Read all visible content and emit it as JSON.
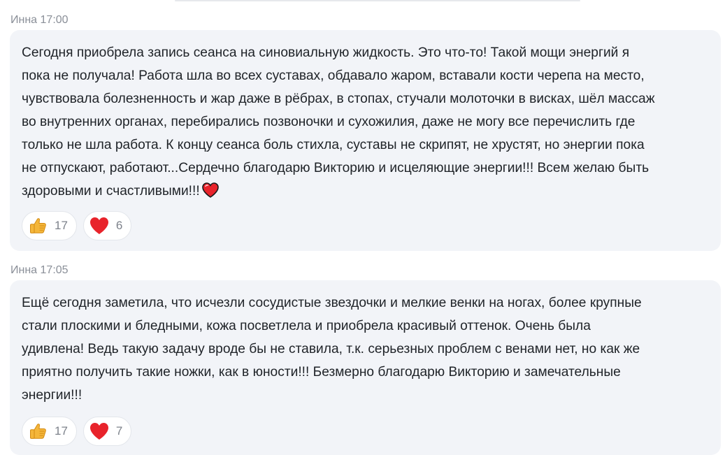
{
  "messages": [
    {
      "author": "Инна",
      "time": "17:00",
      "lines": [
        "Сегодня приобрела запись сеанса на синовиальную жидкость. Это что-то! Такой мощи энергий я",
        "пока не получала! Работа шла во всех суставах, обдавало жаром, вставали кости черепа на место,",
        "чувствовала болезненность и жар даже в рёбрах, в стопах, стучали молоточки в висках, шёл массаж",
        "во внутренних органах, перебирались позвоночки и сухожилия, даже не могу все перечислить где",
        "только не шла работа. К концу сеанса боль стихла, суставы не скрипят, не хрустят, но энергии пока",
        "не отпускают, работают...Сердечно благодарю Викторию и исцеляющие энергии!!! Всем желаю быть",
        "здоровыми и счастливыми!!!"
      ],
      "reactions": [
        {
          "icon": "thumbs-up",
          "count": "17"
        },
        {
          "icon": "red-heart",
          "count": "6"
        }
      ]
    },
    {
      "author": "Инна",
      "time": "17:05",
      "lines": [
        "Ещё сегодня заметила, что исчезли сосудистые звездочки и мелкие венки на ногах, более крупные",
        "стали плоскими и бледными, кожа посветлела и приобрела красивый оттенок. Очень была",
        "удивлена! Ведь такую задачу вроде бы не ставила, т.к. серьезных проблем с венами нет, но как же",
        "приятно получить такие ножки, как в юности!!! Безмерно благодарю Викторию и замечательные",
        "энергии!!!"
      ],
      "reactions": [
        {
          "icon": "thumbs-up",
          "count": "17"
        },
        {
          "icon": "red-heart",
          "count": "7"
        }
      ]
    }
  ],
  "colors": {
    "bubble_bg": "#f2f4f8",
    "meta_text": "#8a8f98",
    "body_text": "#1f2328",
    "heart": "#e8232b",
    "thumb": "#f4b63a"
  }
}
